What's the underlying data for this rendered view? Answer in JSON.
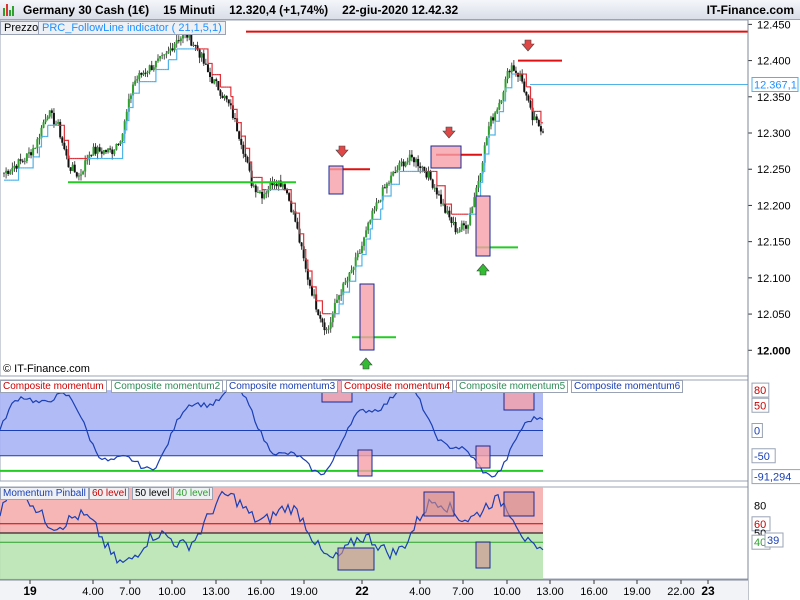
{
  "header": {
    "instrument": "Germany 30 Cash (1€)",
    "timeframe": "15 Minuti",
    "price": "12.320,4 (+1,74%)",
    "datetime": "22-giu-2020 12.42.32",
    "brand": "IT-Finance.com"
  },
  "price_legend": {
    "main": "Prezzo",
    "indicator": "PRC_FollowLine indicator ( 21,1,5,1)"
  },
  "copyright": "© IT-Finance.com",
  "momentum_legend": [
    {
      "label": "Composite momentum",
      "color": "#cc0000"
    },
    {
      "label": "Composite momentum2",
      "color": "#2e8b57"
    },
    {
      "label": "Composite momentum3",
      "color": "#1a3fb4"
    },
    {
      "label": "Composite momentum4",
      "color": "#cc0000"
    },
    {
      "label": "Composite momentum5",
      "color": "#2e8b57"
    },
    {
      "label": "Composite momentum6",
      "color": "#1a3fb4"
    }
  ],
  "pinball_legend": [
    {
      "label": "Momentum Pinball",
      "color": "#1a3fb4"
    },
    {
      "label": "60 level",
      "color": "#cc0000"
    },
    {
      "label": "50 level",
      "color": "#000000"
    },
    {
      "label": "40 level",
      "color": "#2ea02e"
    }
  ],
  "chart_data": [
    {
      "type": "candlestick",
      "title": "Germany 30 Cash (1€) 15 Minuti",
      "ylim": [
        11970,
        12445
      ],
      "yticks": [
        "12.450",
        "12.400",
        "12.350",
        "12.300",
        "12.250",
        "12.200",
        "12.150",
        "12.100",
        "12.050",
        "12.000"
      ],
      "last_price_label": "12.367,1",
      "x_tick_labels": [
        "19",
        "4.00",
        "7.00",
        "10.00",
        "13.00",
        "16.00",
        "19.00",
        "22",
        "4.00",
        "7.00",
        "10.00",
        "13.00",
        "16.00",
        "19.00",
        "22.00",
        "23"
      ],
      "close_path": [
        12245,
        12255,
        12265,
        12285,
        12330,
        12310,
        12255,
        12240,
        12275,
        12275,
        12275,
        12300,
        12370,
        12385,
        12395,
        12405,
        12430,
        12435,
        12415,
        12380,
        12360,
        12335,
        12290,
        12230,
        12215,
        12235,
        12230,
        12180,
        12110,
        12060,
        12025,
        12075,
        12100,
        12135,
        12180,
        12215,
        12240,
        12260,
        12265,
        12250,
        12225,
        12190,
        12165,
        12175,
        12235,
        12310,
        12345,
        12395,
        12375,
        12320,
        12305
      ],
      "resistance_lines": [
        12440,
        12250,
        12270,
        12400
      ],
      "support_lines": [
        12232,
        12018,
        12142
      ]
    },
    {
      "type": "line",
      "title": "Composite momentum",
      "ylim": [
        -100,
        100
      ],
      "levels": [
        80,
        50,
        0,
        -50
      ],
      "last_value": "-91,294",
      "tick_labels": [
        "80",
        "50",
        "0",
        "-50",
        "-91,294"
      ]
    },
    {
      "type": "line",
      "title": "Momentum Pinball",
      "ylim": [
        0,
        100
      ],
      "levels": [
        60,
        50,
        40
      ],
      "last_value": "39",
      "tick_labels": [
        "80",
        "60",
        "50",
        "40",
        "39"
      ]
    }
  ],
  "colors": {
    "bull": "#2ea02e",
    "bear": "#111111",
    "follow_up": "#4fb3e8",
    "follow_down": "#e0303a",
    "resistance": "#dd1111",
    "support": "#22cc22",
    "box_fill": "#f5a0a8",
    "box_stroke": "#1a2a99",
    "momentum_band": "#a9b4f5",
    "pinball_up": "#f4a9a9",
    "pinball_down": "#b9e4b1"
  }
}
